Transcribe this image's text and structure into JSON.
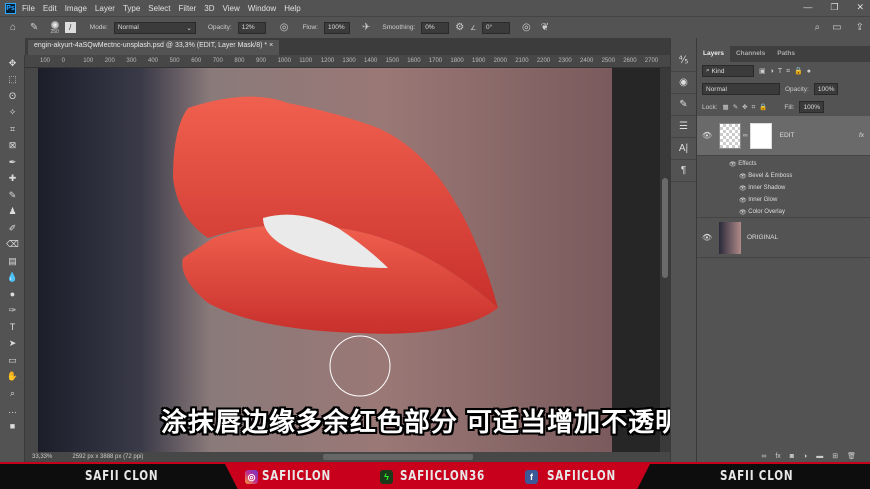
{
  "menubar": {
    "items": [
      "File",
      "Edit",
      "Image",
      "Layer",
      "Type",
      "Select",
      "Filter",
      "3D",
      "View",
      "Window",
      "Help"
    ]
  },
  "options": {
    "brush_size": "250",
    "mode_label": "Mode:",
    "mode": "Normal",
    "opacity_label": "Opacity:",
    "opacity": "12%",
    "flow_label": "Flow:",
    "flow": "100%",
    "smoothing_label": "Smoothing:",
    "smoothing": "0%",
    "angle": "0°"
  },
  "document": {
    "tab_title": "engin-akyurt-4aSQwMectnc-unsplash.psd @ 33,3% (EDIT, Layer Mask/8) *",
    "ruler": [
      "100",
      "0",
      "100",
      "200",
      "300",
      "400",
      "500",
      "600",
      "700",
      "800",
      "900",
      "1000",
      "1100",
      "1200",
      "1300",
      "1400",
      "1500",
      "1600",
      "1700",
      "1800",
      "1900",
      "2000",
      "2100",
      "2200",
      "2300",
      "2400",
      "2500",
      "2600",
      "2700"
    ],
    "subtitle": "涂抹唇边缘多余红色部分  可适当增加不透明度"
  },
  "status": {
    "zoom": "33,33%",
    "dimensions": "2592 px x 3888 px (72 ppi)"
  },
  "layers_panel": {
    "tabs": [
      "Layers",
      "Channels",
      "Paths"
    ],
    "filter": "Kind",
    "blend": "Normal",
    "opacity_label": "Opacity:",
    "opacity": "100%",
    "lock_label": "Lock:",
    "fill_label": "Fill:",
    "fill": "100%",
    "layers": [
      {
        "name": "EDIT",
        "fx": "fx",
        "effects_label": "Effects",
        "effects": [
          "Bevel & Emboss",
          "Inner Shadow",
          "Inner Glow",
          "Color Overlay"
        ]
      },
      {
        "name": "ORIGINAL"
      }
    ]
  },
  "banner": {
    "left": "SAFII CLON",
    "instagram": "SAFIICLON",
    "other": "SAFIICLON36",
    "facebook": "SAFIICLON",
    "right": "SAFII CLON"
  },
  "colors": {
    "lip": "#e8483c",
    "accent": "#c8001c",
    "ps_blue": "#31a8ff"
  }
}
